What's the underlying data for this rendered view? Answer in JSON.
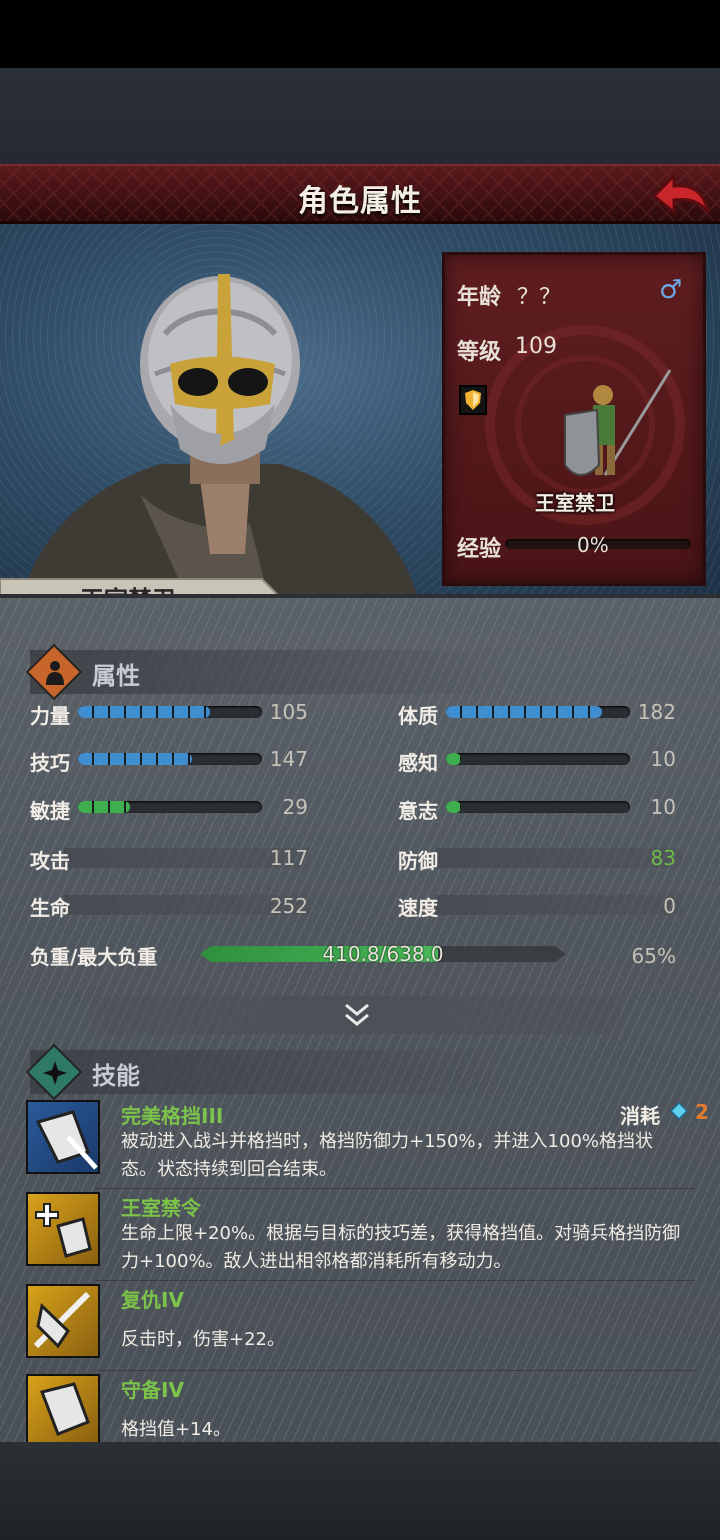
{
  "header": {
    "title": "角色属性"
  },
  "character": {
    "name": "王室禁卫",
    "unit_name": "王室禁卫",
    "age_label": "年龄",
    "age_value": "？？",
    "level_label": "等级",
    "level_value": "109",
    "exp_label": "经验",
    "exp_value": "0%",
    "exp_fraction": 0.0,
    "gender_icon": "male-icon"
  },
  "attributes": {
    "title": "属性",
    "stats": [
      {
        "label": "力量",
        "value": "105",
        "fraction": 0.72,
        "color": "#3f8fd0"
      },
      {
        "label": "体质",
        "value": "182",
        "fraction": 0.85,
        "color": "#3f8fd0"
      },
      {
        "label": "技巧",
        "value": "147",
        "fraction": 0.62,
        "color": "#3f8fd0"
      },
      {
        "label": "感知",
        "value": "10",
        "fraction": 0.08,
        "color": "#3fae4e"
      },
      {
        "label": "敏捷",
        "value": "29",
        "fraction": 0.28,
        "color": "#3fae4e"
      },
      {
        "label": "意志",
        "value": "10",
        "fraction": 0.08,
        "color": "#3fae4e"
      }
    ],
    "flat": [
      {
        "label": "攻击",
        "value": "117"
      },
      {
        "label": "防御",
        "value": "83"
      },
      {
        "label": "生命",
        "value": "252"
      },
      {
        "label": "速度",
        "value": "0"
      }
    ],
    "weight_label": "负重/最大负重",
    "weight_value": "410.8/638.0",
    "weight_percent": "65%",
    "weight_fraction": 0.65,
    "defense_color": "#6dbb45"
  },
  "skills": {
    "title": "技能",
    "cost_label": "消耗",
    "cost_value": "2",
    "items": [
      {
        "name": "完美格挡III",
        "desc": "被动进入战斗并格挡时，格挡防御力+150%，并进入100%格挡状态。状态持续到回合结束。",
        "icon": "parry-icon"
      },
      {
        "name": "王室禁令",
        "desc": "生命上限+20%。根据与目标的技巧差，获得格挡值。对骑兵格挡防御力+100%。敌人进出相邻格都消耗所有移动力。",
        "icon": "royal-edict-icon"
      },
      {
        "name": "复仇IV",
        "desc": "反击时，伤害+22。",
        "icon": "revenge-icon"
      },
      {
        "name": "守备IV",
        "desc": "格挡值+14。",
        "icon": "guard-icon"
      }
    ]
  }
}
